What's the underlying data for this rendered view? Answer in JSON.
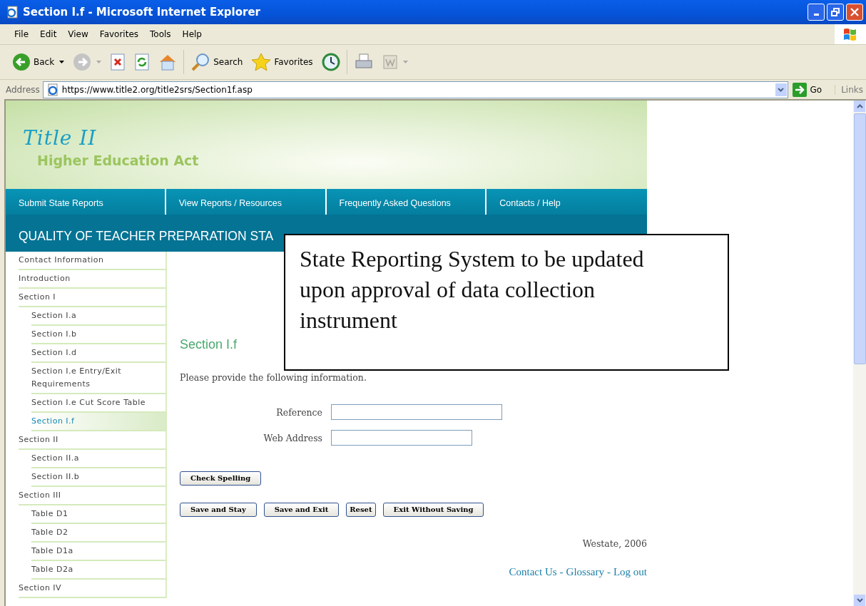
{
  "window": {
    "title": "Section I.f - Microsoft Internet Explorer"
  },
  "menu": [
    "File",
    "Edit",
    "View",
    "Favorites",
    "Tools",
    "Help"
  ],
  "toolbar": [
    {
      "kind": "back",
      "label": "Back"
    },
    {
      "kind": "forward"
    },
    {
      "kind": "stop"
    },
    {
      "kind": "refresh"
    },
    {
      "kind": "home"
    },
    {
      "kind": "search",
      "label": "Search"
    },
    {
      "kind": "favorites",
      "label": "Favorites"
    },
    {
      "kind": "history"
    },
    {
      "kind": "print"
    },
    {
      "kind": "word"
    }
  ],
  "address": {
    "label": "Address",
    "url": "https://www.title2.org/title2srs/Section1f.asp",
    "go": "Go",
    "links": "Links"
  },
  "site": {
    "logo_title": "Title II",
    "logo_subtitle": "Higher Education Act",
    "banner": "QUALITY OF TEACHER PREPARATION STA"
  },
  "nav": [
    "Submit State Reports",
    "View Reports / Resources",
    "Frequently Asked Questions",
    "Contacts / Help"
  ],
  "sidebar": [
    {
      "label": "Contact Information",
      "selected": false
    },
    {
      "label": "Introduction",
      "selected": false
    },
    {
      "label": "Section I",
      "selected": false,
      "children": [
        {
          "label": "Section I.a",
          "selected": false
        },
        {
          "label": "Section I.b",
          "selected": false
        },
        {
          "label": "Section I.d",
          "selected": false
        },
        {
          "label": "Section I.e Entry/Exit Requirements",
          "selected": false
        },
        {
          "label": "Section I.e Cut Score Table",
          "selected": false
        },
        {
          "label": "Section I.f",
          "selected": true
        }
      ]
    },
    {
      "label": "Section II",
      "selected": false,
      "children": [
        {
          "label": "Section II.a",
          "selected": false
        },
        {
          "label": "Section II.b",
          "selected": false
        }
      ]
    },
    {
      "label": "Section III",
      "selected": false,
      "children": [
        {
          "label": "Table D1",
          "selected": false
        },
        {
          "label": "Table D2",
          "selected": false
        },
        {
          "label": "Table D1a",
          "selected": false
        },
        {
          "label": "Table D2a",
          "selected": false
        }
      ]
    },
    {
      "label": "Section IV",
      "selected": false
    }
  ],
  "main": {
    "heading": "Section I.f",
    "intro": "Please provide the following information.",
    "fields": [
      {
        "label": "Reference"
      },
      {
        "label": "Web Address"
      }
    ],
    "spell_button": "Check Spelling",
    "buttons": [
      "Save and Stay",
      "Save and Exit",
      "Reset",
      "Exit Without Saving"
    ],
    "copyright": "Westate, 2006",
    "footer_links": [
      "Contact Us",
      "Glossary",
      "Log out"
    ],
    "footer_separator": "-"
  },
  "notice": "State Reporting System to be updated upon approval of data collection instrument"
}
